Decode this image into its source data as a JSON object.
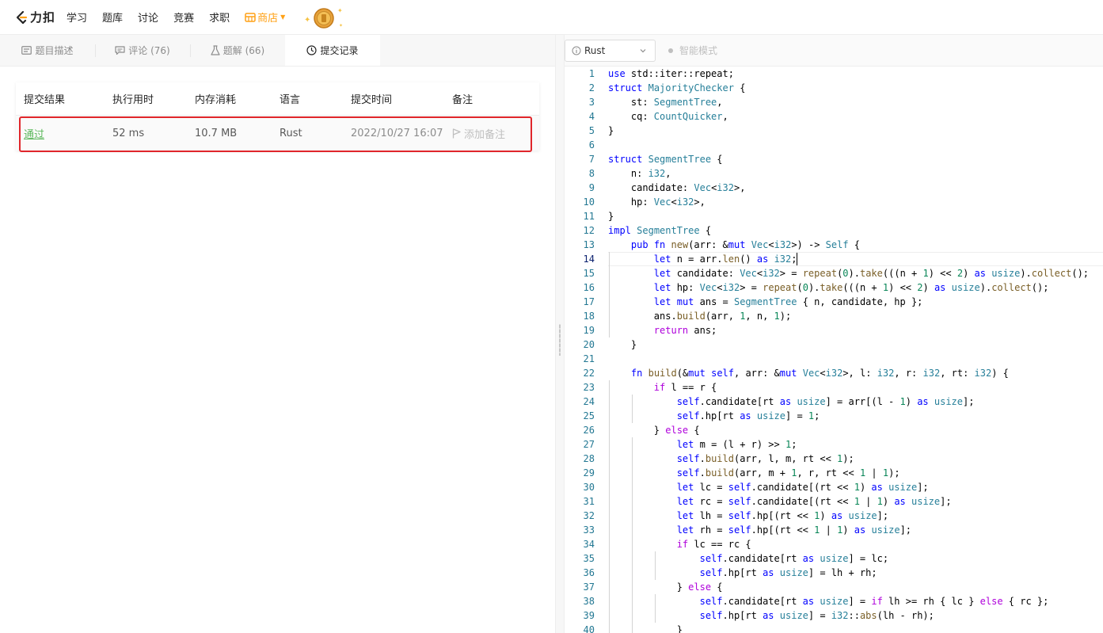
{
  "topnav": {
    "logo_text": "力扣",
    "items": [
      "学习",
      "题库",
      "讨论",
      "竞赛",
      "求职"
    ],
    "store_label": "商店",
    "icons": [
      "leetcode-logo-icon",
      "store-icon",
      "coin-icon"
    ],
    "accent_color": "#ffa116"
  },
  "tabs": [
    {
      "label": "题目描述",
      "icon": "description-icon"
    },
    {
      "label": "评论 (76)",
      "icon": "comment-icon"
    },
    {
      "label": "题解 (66)",
      "icon": "flask-icon"
    },
    {
      "label": "提交记录",
      "icon": "clock-icon",
      "active": true
    }
  ],
  "submissions": {
    "headers": [
      "提交结果",
      "执行用时",
      "内存消耗",
      "语言",
      "提交时间",
      "备注"
    ],
    "rows": [
      {
        "status": "通过",
        "runtime": "52 ms",
        "memory": "10.7 MB",
        "language": "Rust",
        "time": "2022/10/27 16:07",
        "note": "添加备注"
      }
    ],
    "status_color": "#5cb85c",
    "highlight_color": "#e0262b"
  },
  "editor": {
    "language": "Rust",
    "smart_mode_label": "智能模式",
    "cursor_line": 14,
    "lines": [
      "use std::iter::repeat;",
      "struct MajorityChecker {",
      "    st: SegmentTree,",
      "    cq: CountQuicker,",
      "}",
      "",
      "struct SegmentTree {",
      "    n: i32,",
      "    candidate: Vec<i32>,",
      "    hp: Vec<i32>,",
      "}",
      "impl SegmentTree {",
      "    pub fn new(arr: &mut Vec<i32>) -> Self {",
      "        let n = arr.len() as i32;",
      "        let candidate: Vec<i32> = repeat(0).take(((n + 1) << 2) as usize).collect();",
      "        let hp: Vec<i32> = repeat(0).take(((n + 1) << 2) as usize).collect();",
      "        let mut ans = SegmentTree { n, candidate, hp };",
      "        ans.build(arr, 1, n, 1);",
      "        return ans;",
      "    }",
      "",
      "    fn build(&mut self, arr: &mut Vec<i32>, l: i32, r: i32, rt: i32) {",
      "        if l == r {",
      "            self.candidate[rt as usize] = arr[(l - 1) as usize];",
      "            self.hp[rt as usize] = 1;",
      "        } else {",
      "            let m = (l + r) >> 1;",
      "            self.build(arr, l, m, rt << 1);",
      "            self.build(arr, m + 1, r, rt << 1 | 1);",
      "            let lc = self.candidate[(rt << 1) as usize];",
      "            let rc = self.candidate[(rt << 1 | 1) as usize];",
      "            let lh = self.hp[(rt << 1) as usize];",
      "            let rh = self.hp[(rt << 1 | 1) as usize];",
      "            if lc == rc {",
      "                self.candidate[rt as usize] = lc;",
      "                self.hp[rt as usize] = lh + rh;",
      "            } else {",
      "                self.candidate[rt as usize] = if lh >= rh { lc } else { rc };",
      "                self.hp[rt as usize] = i32::abs(lh - rh);",
      "            }"
    ]
  }
}
